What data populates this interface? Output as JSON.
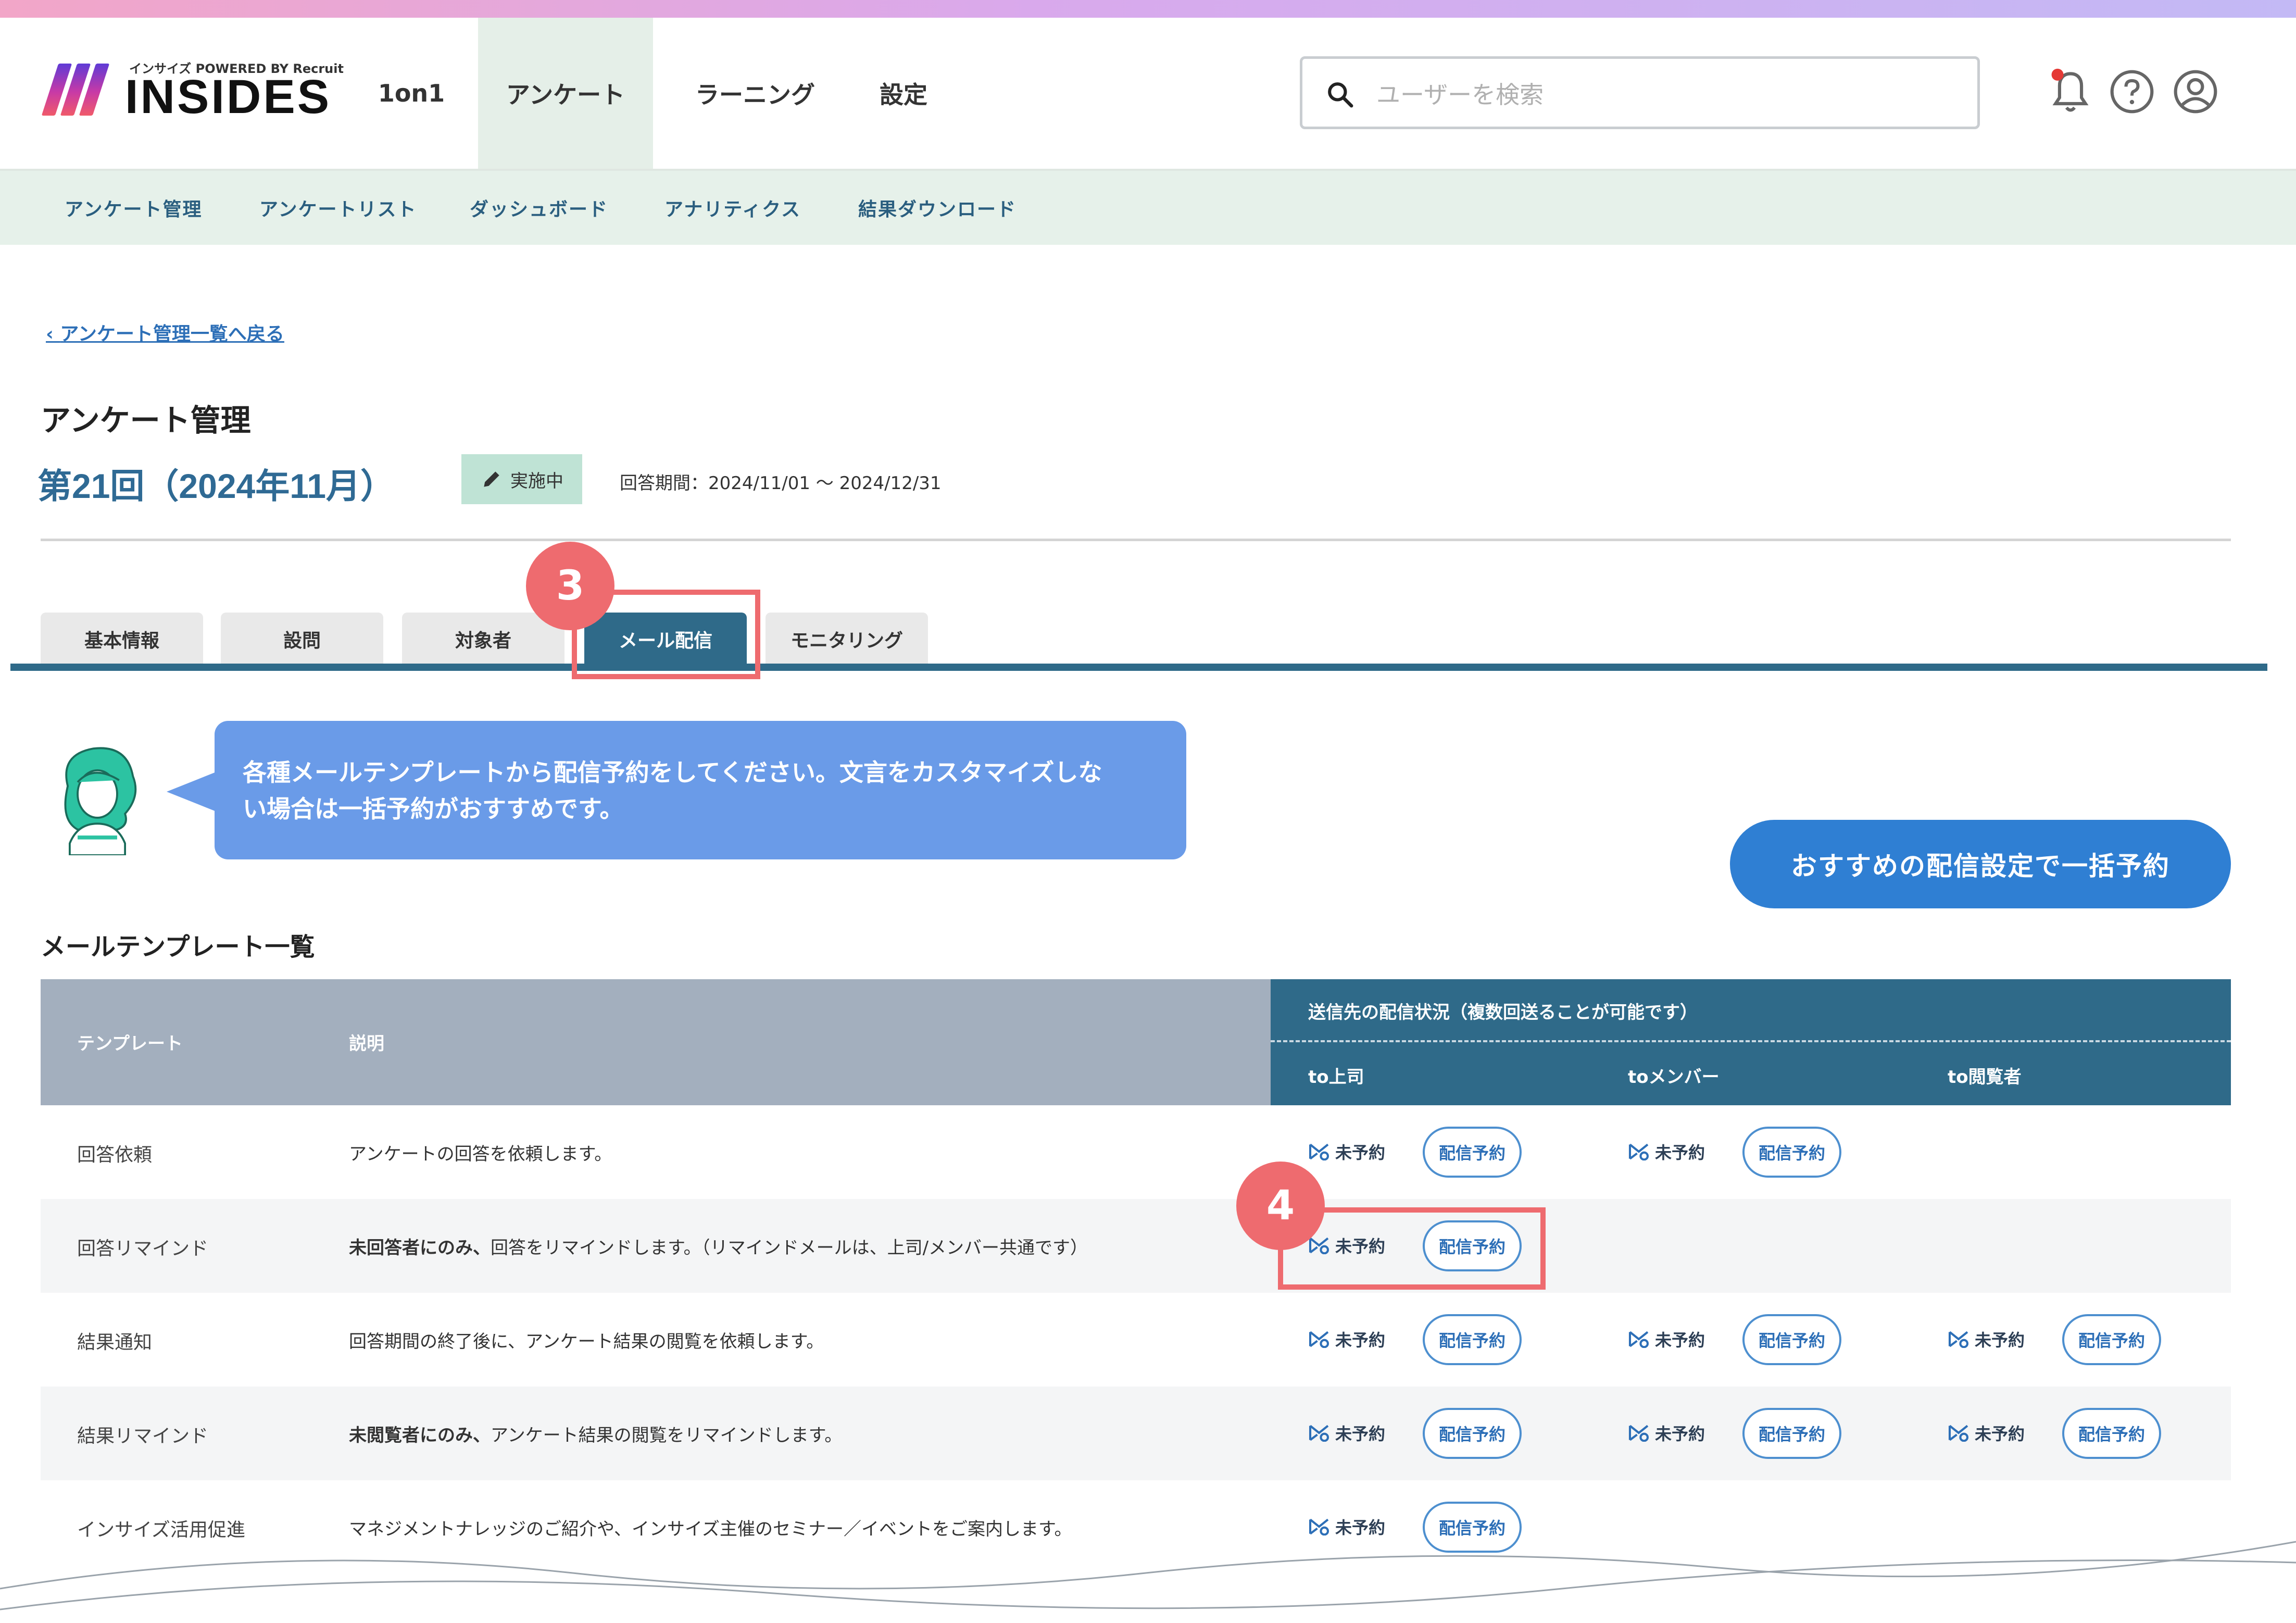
{
  "app": {
    "logo_text": "INSIDES",
    "logo_sub": "インサイズ POWERED BY Recruit"
  },
  "nav": {
    "items": [
      {
        "label": "1on1"
      },
      {
        "label": "アンケート"
      },
      {
        "label": "ラーニング"
      },
      {
        "label": "設定"
      }
    ],
    "active_index": 1
  },
  "search": {
    "placeholder": "ユーザーを検索"
  },
  "subnav": {
    "items": [
      "アンケート管理",
      "アンケートリスト",
      "ダッシュボード",
      "アナリティクス",
      "結果ダウンロード"
    ]
  },
  "breadcrumb": {
    "back_label": "アンケート管理一覧へ戻る"
  },
  "page": {
    "title": "アンケート管理",
    "survey_name": "第21回（2024年11月）",
    "status": "実施中",
    "period": "回答期間：2024/11/01 ～ 2024/12/31"
  },
  "tabs": [
    "基本情報",
    "設問",
    "対象者",
    "メール配信",
    "モニタリング"
  ],
  "annotations": {
    "step3": "3",
    "step4": "4"
  },
  "message": {
    "text_line1": "各種メールテンプレートから配信予約をしてください。文言をカスタマイズしな",
    "text_line2": "い場合は一括予約がおすすめです。",
    "bulk_button": "おすすめの配信設定で一括予約"
  },
  "templates": {
    "section_title": "メールテンプレート一覧",
    "headers": {
      "template": "テンプレート",
      "description": "説明",
      "status_group": "送信先の配信状況（複数回送ることが可能です）",
      "to_boss": "to上司",
      "to_member": "toメンバー",
      "to_viewer": "to閲覧者"
    },
    "status_label": "未予約",
    "schedule_label": "配信予約",
    "rows": [
      {
        "name": "回答依頼",
        "desc_bold": "",
        "desc": "アンケートの回答を依頼します。"
      },
      {
        "name": "回答リマインド",
        "desc_bold": "未回答者にのみ、",
        "desc": "回答をリマインドします。（リマインドメールは、上司/メンバー共通です）"
      },
      {
        "name": "結果通知",
        "desc_bold": "",
        "desc": "回答期間の終了後に、アンケート結果の閲覧を依頼します。"
      },
      {
        "name": "結果リマインド",
        "desc_bold": "未閲覧者にのみ、",
        "desc": "アンケート結果の閲覧をリマインドします。"
      },
      {
        "name": "インサイズ活用促進",
        "desc_bold": "",
        "desc": "マネジメントナレッジのご紹介や、インサイズ主催のセミナー／イベントをご案内します。"
      }
    ]
  },
  "colors": {
    "accent": "#2f6a89",
    "highlight": "#ee6b6f",
    "bubble": "#6a9be8",
    "primary_button": "#2f7fd3"
  }
}
